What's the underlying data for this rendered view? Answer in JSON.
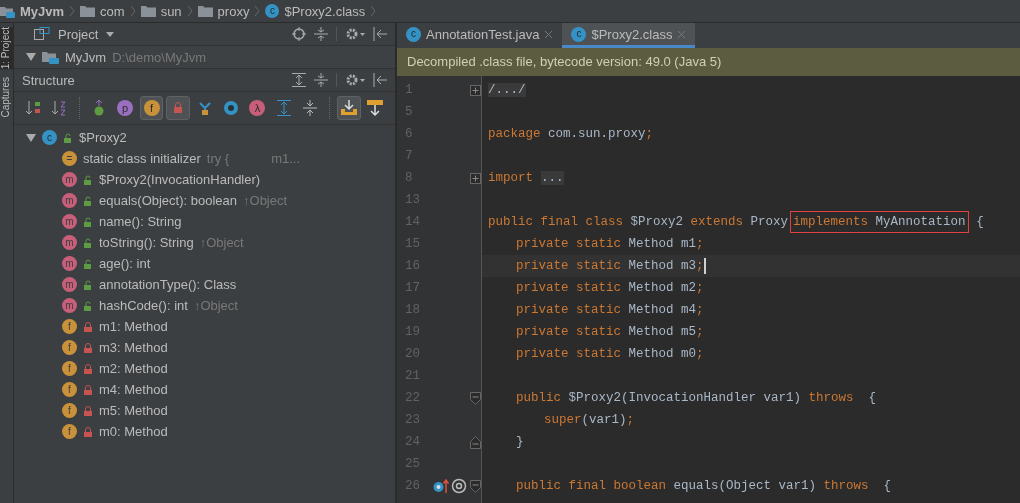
{
  "breadcrumbs": [
    {
      "label": "MyJvm",
      "kind": "project"
    },
    {
      "label": "com",
      "kind": "folder"
    },
    {
      "label": "sun",
      "kind": "folder"
    },
    {
      "label": "proxy",
      "kind": "folder"
    },
    {
      "label": "$Proxy2.class",
      "kind": "class",
      "badge": "c"
    }
  ],
  "side_strip": [
    "1: Project",
    "Captures"
  ],
  "project_panel": {
    "title": "Project",
    "root": {
      "label": "MyJvm",
      "path": "D:\\demo\\MyJvm",
      "expanded": true
    }
  },
  "structure": {
    "title": "Structure",
    "toolbar": [
      {
        "kind": "sort-visibility",
        "selected": false
      },
      {
        "kind": "sort-alpha",
        "selected": false
      },
      {
        "kind": "separator"
      },
      {
        "kind": "inherited",
        "selected": false
      },
      {
        "kind": "letter",
        "glyph": "p",
        "color": "#9a6fc0",
        "selected": false
      },
      {
        "kind": "letter",
        "glyph": "f",
        "color": "#c8913a",
        "selected": true
      },
      {
        "kind": "lock",
        "selected": true
      },
      {
        "kind": "hierarchy",
        "selected": false
      },
      {
        "kind": "ring",
        "color": "#3592c4",
        "selected": false
      },
      {
        "kind": "letter",
        "glyph": "λ",
        "color": "#c75f7a",
        "selected": false
      },
      {
        "kind": "expand",
        "selected": false
      },
      {
        "kind": "collapse",
        "selected": false
      },
      {
        "kind": "separator"
      },
      {
        "kind": "autoscroll-to",
        "selected": true
      },
      {
        "kind": "autoscroll-from",
        "selected": false
      }
    ],
    "tree": {
      "label": "$Proxy2",
      "badge": "c",
      "expanded": true,
      "children": [
        {
          "kind": "initializer",
          "badge": "=",
          "label": "static class initializer",
          "detail": "try {",
          "detail_2": "m1..."
        },
        {
          "kind": "method",
          "badge": "m",
          "private": false,
          "label": "$Proxy2(InvocationHandler)"
        },
        {
          "kind": "method",
          "badge": "m",
          "private": false,
          "label": "equals(Object): boolean",
          "detail": "↑Object"
        },
        {
          "kind": "method",
          "badge": "m",
          "private": false,
          "label": "name(): String"
        },
        {
          "kind": "method",
          "badge": "m",
          "private": false,
          "label": "toString(): String",
          "detail": "↑Object"
        },
        {
          "kind": "method",
          "badge": "m",
          "private": false,
          "label": "age(): int"
        },
        {
          "kind": "method",
          "badge": "m",
          "private": false,
          "label": "annotationType(): Class"
        },
        {
          "kind": "method",
          "badge": "m",
          "private": false,
          "label": "hashCode(): int",
          "detail": "↑Object"
        },
        {
          "kind": "field",
          "badge": "f",
          "private": true,
          "label": "m1: Method"
        },
        {
          "kind": "field",
          "badge": "f",
          "private": true,
          "label": "m3: Method"
        },
        {
          "kind": "field",
          "badge": "f",
          "private": true,
          "label": "m2: Method"
        },
        {
          "kind": "field",
          "badge": "f",
          "private": true,
          "label": "m4: Method"
        },
        {
          "kind": "field",
          "badge": "f",
          "private": true,
          "label": "m5: Method"
        },
        {
          "kind": "field",
          "badge": "f",
          "private": true,
          "label": "m0: Method"
        }
      ]
    }
  },
  "editor": {
    "tabs": [
      {
        "label": "AnnotationTest.java",
        "badge": "c",
        "selected": false
      },
      {
        "label": "$Proxy2.class",
        "badge": "c",
        "selected": true
      }
    ],
    "notice": "Decompiled .class file, bytecode version: 49.0 (Java 5)",
    "lines": [
      {
        "num": "1",
        "fold": {
          "kind": "plus"
        },
        "tokens": [
          {
            "text": "/.../",
            "kind": "folded"
          }
        ]
      },
      {
        "num": "5"
      },
      {
        "num": "6",
        "tokens": [
          {
            "text": "package",
            "kind": "keyword"
          },
          {
            "text": " com.sun.proxy",
            "kind": "plain"
          },
          {
            "text": ";",
            "kind": "keyword"
          }
        ]
      },
      {
        "num": "7"
      },
      {
        "num": "8",
        "fold": {
          "kind": "plus"
        },
        "tokens": [
          {
            "text": "import",
            "kind": "keyword"
          },
          {
            "text": "...",
            "kind": "folded"
          }
        ]
      },
      {
        "num": "13"
      },
      {
        "num": "14",
        "tokens": [
          {
            "text": "public final class",
            "kind": "keyword"
          },
          {
            "text": " $Proxy2 ",
            "kind": "plain"
          },
          {
            "text": "extends",
            "kind": "keyword"
          },
          {
            "text": " Proxy",
            "kind": "plain"
          },
          {
            "kind": "boxed",
            "tokens": [
              {
                "text": "implements",
                "kind": "keyword"
              },
              {
                "text": " MyAnnotation",
                "kind": "plain"
              }
            ]
          },
          {
            "text": " {",
            "kind": "plain"
          }
        ]
      },
      {
        "num": "15",
        "indent": {
          "kind": "member"
        },
        "tokens": [
          {
            "text": "private static",
            "kind": "keyword"
          },
          {
            "text": " Method m1",
            "kind": "plain"
          },
          {
            "text": ";",
            "kind": "keyword"
          }
        ]
      },
      {
        "num": "16",
        "indent": {
          "kind": "member"
        },
        "current": true,
        "tokens": [
          {
            "text": "private static",
            "kind": "keyword"
          },
          {
            "text": " Method m3",
            "kind": "plain"
          },
          {
            "text": ";",
            "kind": "keyword"
          }
        ]
      },
      {
        "num": "17",
        "indent": {
          "kind": "member"
        },
        "tokens": [
          {
            "text": "private static",
            "kind": "keyword"
          },
          {
            "text": " Method m2",
            "kind": "plain"
          },
          {
            "text": ";",
            "kind": "keyword"
          }
        ]
      },
      {
        "num": "18",
        "indent": {
          "kind": "member"
        },
        "tokens": [
          {
            "text": "private static",
            "kind": "keyword"
          },
          {
            "text": " Method m4",
            "kind": "plain"
          },
          {
            "text": ";",
            "kind": "keyword"
          }
        ]
      },
      {
        "num": "19",
        "indent": {
          "kind": "member"
        },
        "tokens": [
          {
            "text": "private static",
            "kind": "keyword"
          },
          {
            "text": " Method m5",
            "kind": "plain"
          },
          {
            "text": ";",
            "kind": "keyword"
          }
        ]
      },
      {
        "num": "20",
        "indent": {
          "kind": "member"
        },
        "tokens": [
          {
            "text": "private static",
            "kind": "keyword"
          },
          {
            "text": " Method m0",
            "kind": "plain"
          },
          {
            "text": ";",
            "kind": "keyword"
          }
        ]
      },
      {
        "num": "21"
      },
      {
        "num": "22",
        "indent": {
          "kind": "member"
        },
        "fold": {
          "kind": "start"
        },
        "tokens": [
          {
            "text": "public",
            "kind": "keyword"
          },
          {
            "text": " $Proxy2(InvocationHandler var1) ",
            "kind": "plain"
          },
          {
            "text": "throws",
            "kind": "keyword"
          },
          {
            "text": "  {",
            "kind": "plain"
          }
        ]
      },
      {
        "num": "23",
        "indent": {
          "kind": "body"
        },
        "tokens": [
          {
            "text": "super",
            "kind": "keyword"
          },
          {
            "text": "(var1)",
            "kind": "plain"
          },
          {
            "text": ";",
            "kind": "keyword"
          }
        ]
      },
      {
        "num": "24",
        "indent": {
          "kind": "member"
        },
        "fold": {
          "kind": "end"
        },
        "tokens": [
          {
            "text": "}",
            "kind": "plain"
          }
        ]
      },
      {
        "num": "25"
      },
      {
        "num": "26",
        "indent": {
          "kind": "member"
        },
        "fold": {
          "kind": "start"
        },
        "markers": [
          {
            "kind": "override"
          },
          {
            "kind": "annotation"
          }
        ],
        "tokens": [
          {
            "text": "public final boolean",
            "kind": "keyword"
          },
          {
            "text": " equals(Object var1) ",
            "kind": "plain"
          },
          {
            "text": "throws",
            "kind": "keyword"
          },
          {
            "text": "  {",
            "kind": "plain"
          }
        ]
      }
    ]
  }
}
